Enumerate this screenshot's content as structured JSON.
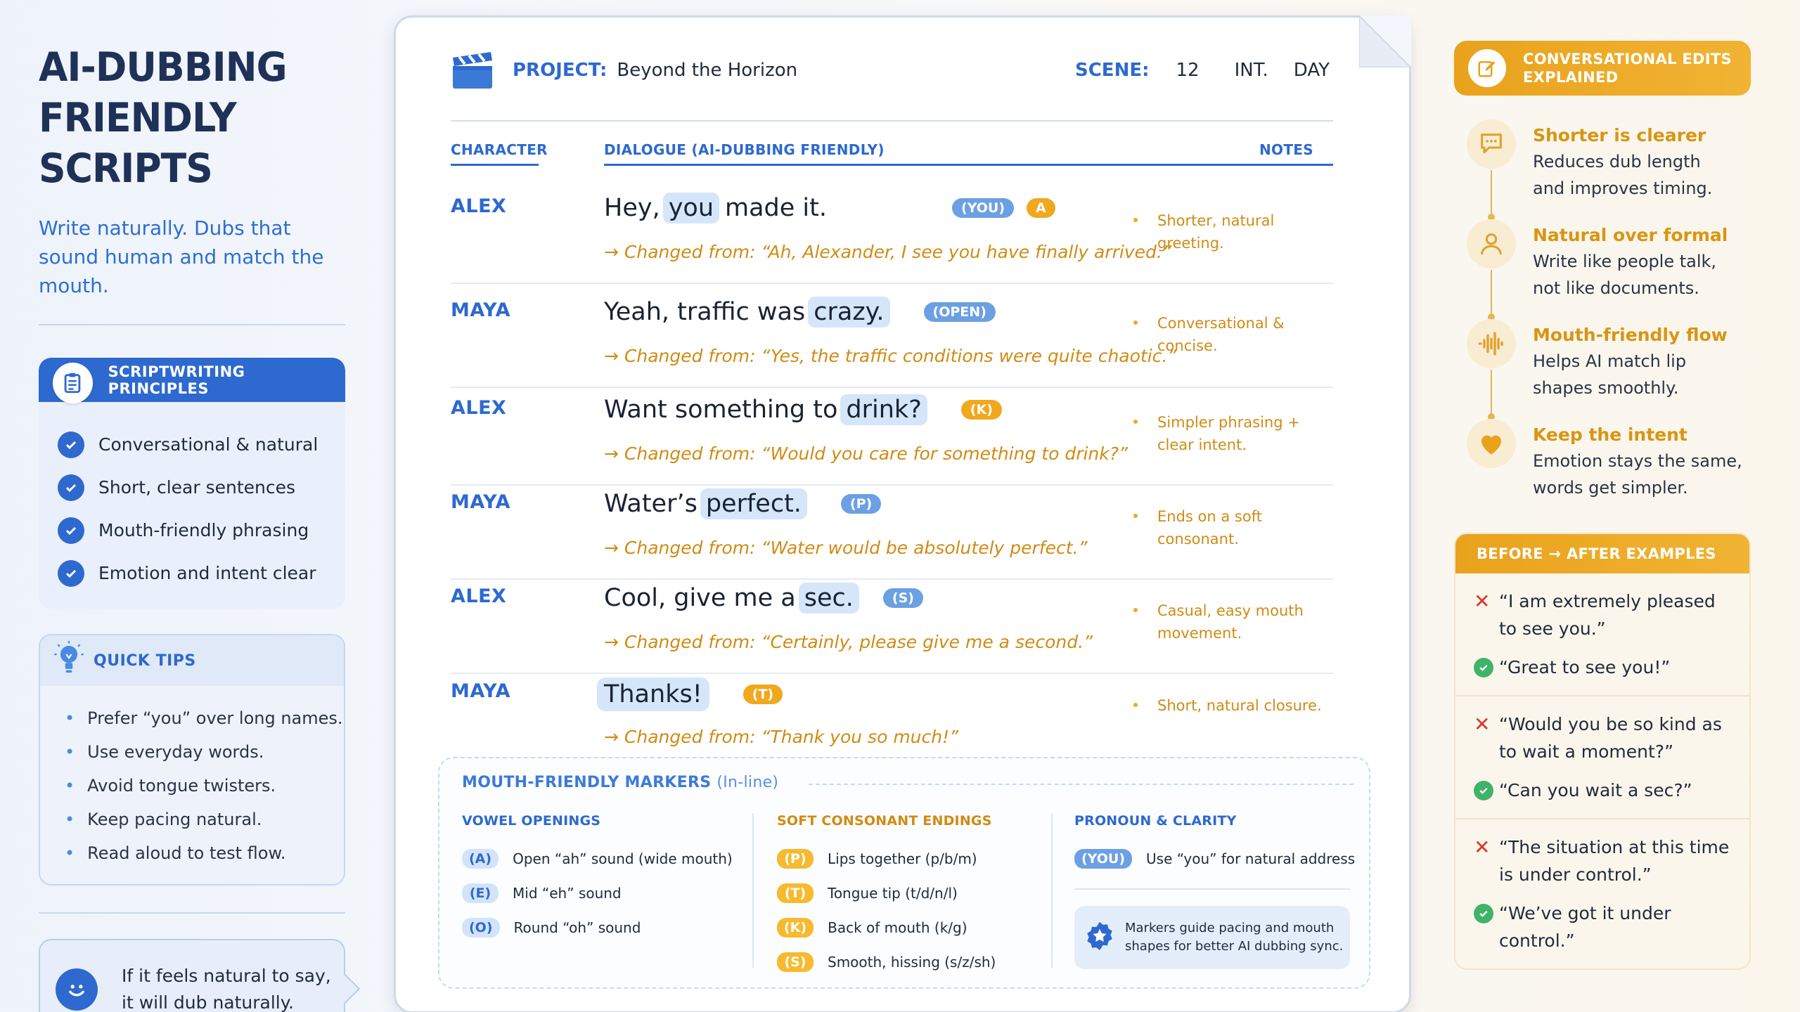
{
  "left": {
    "title": "AI-DUBBING\nFRIENDLY SCRIPTS",
    "subtitle": "Write naturally. Dubs that sound human and match the mouth.",
    "principles": {
      "title": "SCRIPTWRITING PRINCIPLES",
      "items": [
        "Conversational & natural",
        "Short, clear sentences",
        "Mouth-friendly phrasing",
        "Emotion and intent clear"
      ]
    },
    "tips": {
      "title": "QUICK TIPS",
      "items": [
        "Prefer “you” over long names.",
        "Use everyday words.",
        "Avoid tongue twisters.",
        "Keep pacing natural.",
        "Read aloud to test flow."
      ]
    },
    "quote": "If it feels natural to say,\nit will dub naturally."
  },
  "header": {
    "project_label": "PROJECT:",
    "project_name": "Beyond the Horizon",
    "scene_label": "SCENE:",
    "scene_number": "12",
    "scene_int": "INT.",
    "scene_time": "DAY"
  },
  "columns": {
    "character": "CHARACTER",
    "dialogue": "DIALOGUE (AI-DUBBING FRIENDLY)",
    "notes": "NOTES"
  },
  "rows": [
    {
      "character": "ALEX",
      "pre": "Hey,",
      "highlight": "you",
      "post": "made it.",
      "tags": [
        {
          "text": "(YOU)",
          "color": "blue"
        },
        {
          "text": "A",
          "color": "orange"
        }
      ],
      "changed": "→ Changed from: “Ah, Alexander, I see you have finally arrived.”",
      "note": "Shorter, natural greeting."
    },
    {
      "character": "MAYA",
      "pre": "Yeah, traffic was",
      "highlight": "crazy.",
      "post": "",
      "tags": [
        {
          "text": "(OPEN)",
          "color": "blue"
        }
      ],
      "changed": "→ Changed from: “Yes, the traffic conditions were quite chaotic.”",
      "note": "Conversational & concise."
    },
    {
      "character": "ALEX",
      "pre": "Want something to",
      "highlight": "drink?",
      "post": "",
      "tags": [
        {
          "text": "(K)",
          "color": "orange"
        }
      ],
      "changed": "→ Changed from: “Would you care for something to drink?”",
      "note": "Simpler phrasing + clear intent."
    },
    {
      "character": "MAYA",
      "pre": "Water’s",
      "highlight": "perfect.",
      "post": "",
      "tags": [
        {
          "text": "(P)",
          "color": "blue"
        }
      ],
      "changed": "→ Changed from: “Water would be absolutely perfect.”",
      "note": "Ends on a soft consonant."
    },
    {
      "character": "ALEX",
      "pre": "Cool, give me a",
      "highlight": "sec.",
      "post": "",
      "tags": [
        {
          "text": "(S)",
          "color": "blue"
        }
      ],
      "changed": "→ Changed from: “Certainly, please give me a second.”",
      "note": "Casual, easy mouth movement."
    },
    {
      "character": "MAYA",
      "pre": "",
      "highlight": "Thanks!",
      "post": "",
      "tags": [
        {
          "text": "(T)",
          "color": "orange"
        }
      ],
      "changed": "→ Changed from: “Thank you so much!”",
      "note": "Short, natural closure."
    }
  ],
  "markers": {
    "title": "MOUTH-FRIENDLY MARKERS",
    "title_suffix": "(In-line)",
    "vowel": {
      "title": "VOWEL OPENINGS",
      "items": [
        {
          "tag": "(A)",
          "text": "Open “ah” sound (wide mouth)"
        },
        {
          "tag": "(E)",
          "text": "Mid “eh” sound"
        },
        {
          "tag": "(O)",
          "text": "Round “oh” sound"
        }
      ]
    },
    "soft": {
      "title": "SOFT CONSONANT ENDINGS",
      "items": [
        {
          "tag": "(P)",
          "text": "Lips together (p/b/m)"
        },
        {
          "tag": "(T)",
          "text": "Tongue tip (t/d/n/l)"
        },
        {
          "tag": "(K)",
          "text": "Back of mouth (k/g)"
        },
        {
          "tag": "(S)",
          "text": "Smooth, hissing (s/z/sh)"
        }
      ]
    },
    "pronoun": {
      "title": "PRONOUN & CLARITY",
      "tag": "(YOU)",
      "text": "Use “you” for natural address",
      "guide": "Markers guide pacing and mouth\nshapes for better AI dubbing sync."
    }
  },
  "right": {
    "edits_title": "CONVERSATIONAL EDITS\nEXPLAINED",
    "edits": [
      {
        "title": "Shorter is clearer",
        "desc": "Reduces dub length\nand improves timing.",
        "icon": "chat-icon"
      },
      {
        "title": "Natural over formal",
        "desc": "Write like people talk,\nnot like documents.",
        "icon": "person-icon"
      },
      {
        "title": "Mouth-friendly flow",
        "desc": "Helps AI match lip\nshapes smoothly.",
        "icon": "soundwave-icon"
      },
      {
        "title": "Keep the intent",
        "desc": "Emotion stays the same,\nwords get simpler.",
        "icon": "heart-icon"
      }
    ],
    "ba_title": "BEFORE → AFTER EXAMPLES",
    "examples": [
      {
        "before": "“I am extremely pleased\nto see you.”",
        "after": "“Great to see you!”"
      },
      {
        "before": "“Would you be so kind as\nto wait a moment?”",
        "after": "“Can you wait a sec?”"
      },
      {
        "before": "“The situation at this time\nis under control.”",
        "after": "“We’ve got it under control.”"
      }
    ]
  },
  "colors": {
    "accent_blue": "#2d69cf",
    "accent_orange": "#f0a81d",
    "note_orange": "#d08b14",
    "error_red": "#d9362b",
    "ok_green": "#3fb36a"
  }
}
